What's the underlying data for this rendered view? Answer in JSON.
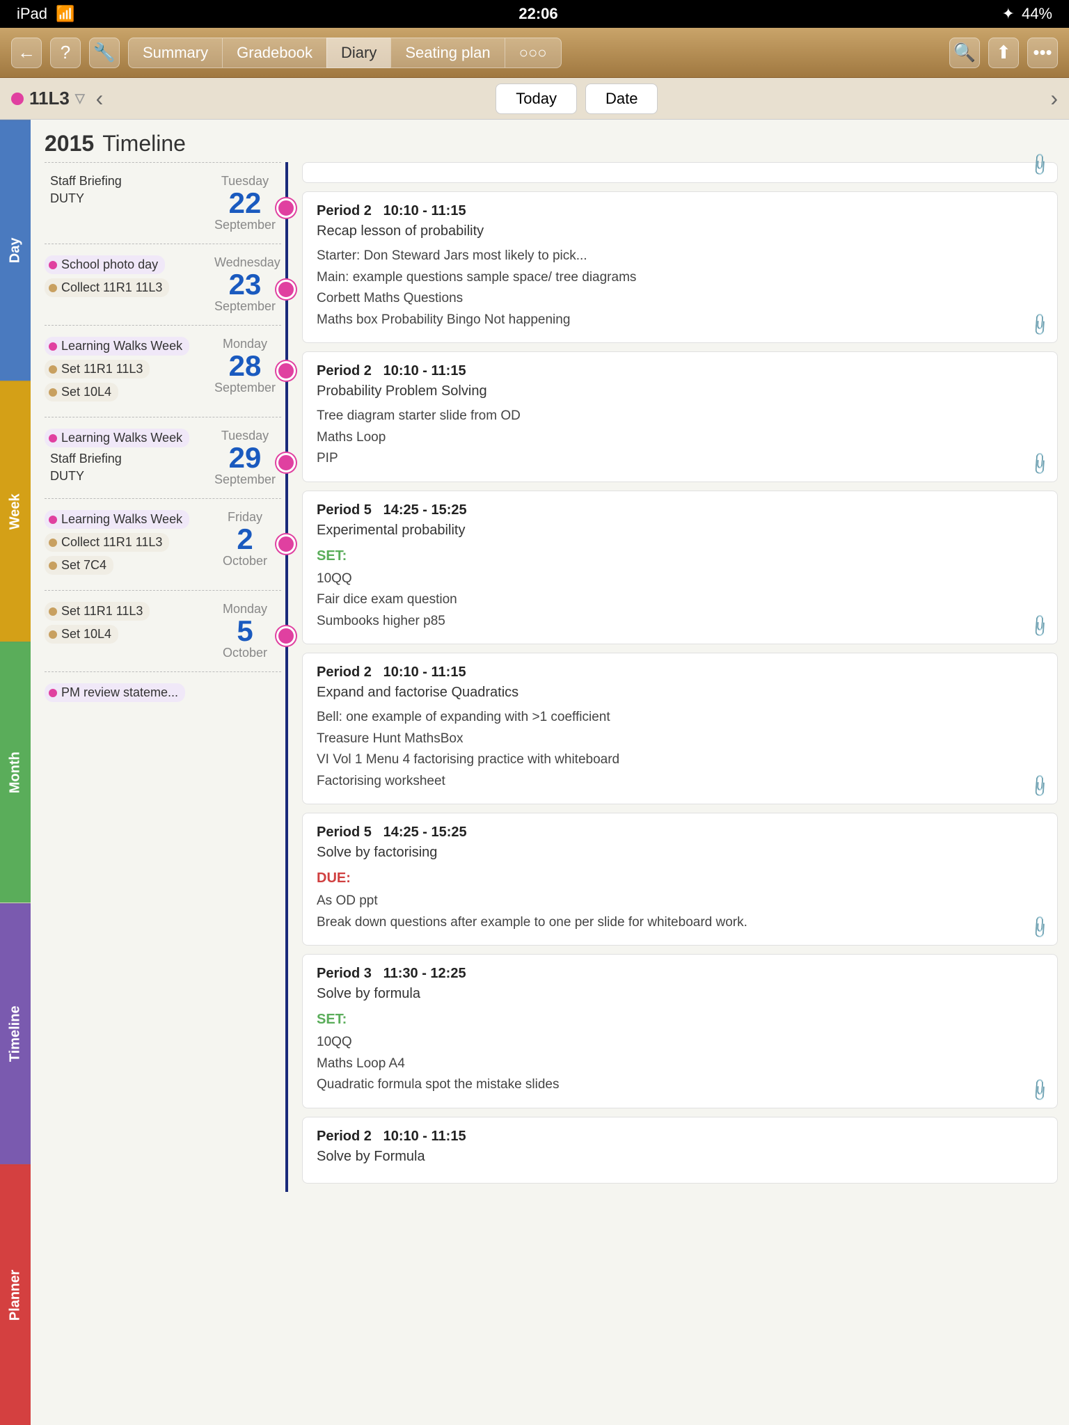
{
  "statusBar": {
    "left": "iPad ✦",
    "time": "22:06",
    "battery": "44%",
    "bluetooth": "✦"
  },
  "navTabs": [
    {
      "label": "Summary",
      "active": false
    },
    {
      "label": "Gradebook",
      "active": false
    },
    {
      "label": "Diary",
      "active": true
    },
    {
      "label": "Seating plan",
      "active": false
    },
    {
      "label": "○○○",
      "active": false
    }
  ],
  "classLabel": "11L3",
  "subNavButtons": [
    "Today",
    "Date"
  ],
  "yearTitle": "2015",
  "pageTitle": "Timeline",
  "sidebarTabs": [
    {
      "label": "Day",
      "class": "tab-day"
    },
    {
      "label": "Week",
      "class": "tab-week"
    },
    {
      "label": "Month",
      "class": "tab-month"
    },
    {
      "label": "Timeline",
      "class": "tab-timeline"
    },
    {
      "label": "Planner",
      "class": "tab-planner"
    }
  ],
  "sections": [
    {
      "dayName": "Tuesday",
      "dayNum": "22",
      "month": "September",
      "dotTop": "40px",
      "events": [
        {
          "dot": "dot-pink",
          "label": "Staff Briefing"
        },
        {
          "dot": "dot-red",
          "label": "DUTY"
        }
      ],
      "lessons": [
        {
          "period": "Period 2",
          "time": "10:10 - 11:15",
          "title": "Recap lesson of probability",
          "body": [
            "Starter: Don Steward Jars most likely to pick...",
            "Main: example questions sample space/ tree diagrams",
            "Corbett Maths Questions",
            "Maths box Probability Bingo Not happening"
          ],
          "set": null,
          "due": null,
          "hasAttach": true
        },
        {
          "period": "Period 2",
          "time": "10:10 - 11:15",
          "title": "Probability Problem Solving",
          "body": [
            "Tree diagram starter slide from OD",
            "Maths Loop",
            "PIP"
          ],
          "set": null,
          "due": null,
          "hasAttach": true
        }
      ]
    },
    {
      "dayName": "Wednesday",
      "dayNum": "23",
      "month": "September",
      "dotTop": "40px",
      "events": [
        {
          "dot": "dot-pink",
          "label": "School photo day"
        },
        {
          "dot": "dot-tan",
          "label": "Collect 11R1 11L3"
        }
      ],
      "lessons": []
    },
    {
      "dayName": "Monday",
      "dayNum": "28",
      "month": "September",
      "dotTop": "40px",
      "events": [
        {
          "dot": "dot-pink",
          "label": "Learning Walks Week"
        },
        {
          "dot": "dot-tan",
          "label": "Set 11R1 11L3"
        },
        {
          "dot": "dot-tan",
          "label": "Set 10L4"
        }
      ],
      "lessons": [
        {
          "period": "Period 5",
          "time": "14:25 - 15:25",
          "title": "Experimental probability",
          "body": [
            "10QQ",
            "Fair dice exam question",
            "Sumbooks higher p85"
          ],
          "set": "SET:",
          "due": null,
          "hasAttach": true
        }
      ]
    },
    {
      "dayName": "Tuesday",
      "dayNum": "29",
      "month": "September",
      "dotTop": "40px",
      "events": [
        {
          "dot": "dot-pink",
          "label": "Learning Walks Week"
        },
        {
          "dot": "dot-pink",
          "label": "Staff Briefing"
        },
        {
          "dot": "dot-red",
          "label": "DUTY"
        }
      ],
      "lessons": [
        {
          "period": "Period 2",
          "time": "10:10 - 11:15",
          "title": "Expand and factorise Quadratics",
          "body": [
            "Bell: one example of expanding with >1 coefficient",
            "Treasure Hunt MathsBox",
            "VI Vol 1 Menu 4 factorising practice with whiteboard",
            "Factorising worksheet"
          ],
          "set": null,
          "due": null,
          "hasAttach": true
        }
      ]
    },
    {
      "dayName": "Friday",
      "dayNum": "2",
      "month": "October",
      "dotTop": "40px",
      "events": [
        {
          "dot": "dot-pink",
          "label": "Learning Walks Week"
        },
        {
          "dot": "dot-tan",
          "label": "Collect 11R1 11L3"
        },
        {
          "dot": "dot-tan",
          "label": "Set 7C4"
        }
      ],
      "lessons": [
        {
          "period": "Period 5",
          "time": "14:25 - 15:25",
          "title": "Solve by factorising",
          "body": [
            "As OD ppt",
            "Break down questions after example to one per slide for whiteboard work."
          ],
          "set": null,
          "due": "DUE:",
          "hasAttach": true
        },
        {
          "period": "Period 3",
          "time": "11:30 - 12:25",
          "title": "Solve by formula",
          "body": [
            "10QQ",
            "Maths Loop A4",
            "Quadratic formula spot the mistake slides"
          ],
          "set": "SET:",
          "due": null,
          "hasAttach": true
        }
      ]
    },
    {
      "dayName": "Monday",
      "dayNum": "5",
      "month": "October",
      "dotTop": "40px",
      "events": [
        {
          "dot": "dot-tan",
          "label": "Set 11R1 11L3"
        },
        {
          "dot": "dot-tan",
          "label": "Set 10L4"
        }
      ],
      "lessons": [
        {
          "period": "Period 2",
          "time": "10:10 - 11:15",
          "title": "Solve by Formula",
          "body": [],
          "set": null,
          "due": null,
          "hasAttach": false
        }
      ]
    },
    {
      "dayName": "",
      "dayNum": "",
      "month": "",
      "dotTop": "40px",
      "events": [
        {
          "dot": "dot-pink",
          "label": "PM review stateme..."
        }
      ],
      "lessons": []
    }
  ]
}
